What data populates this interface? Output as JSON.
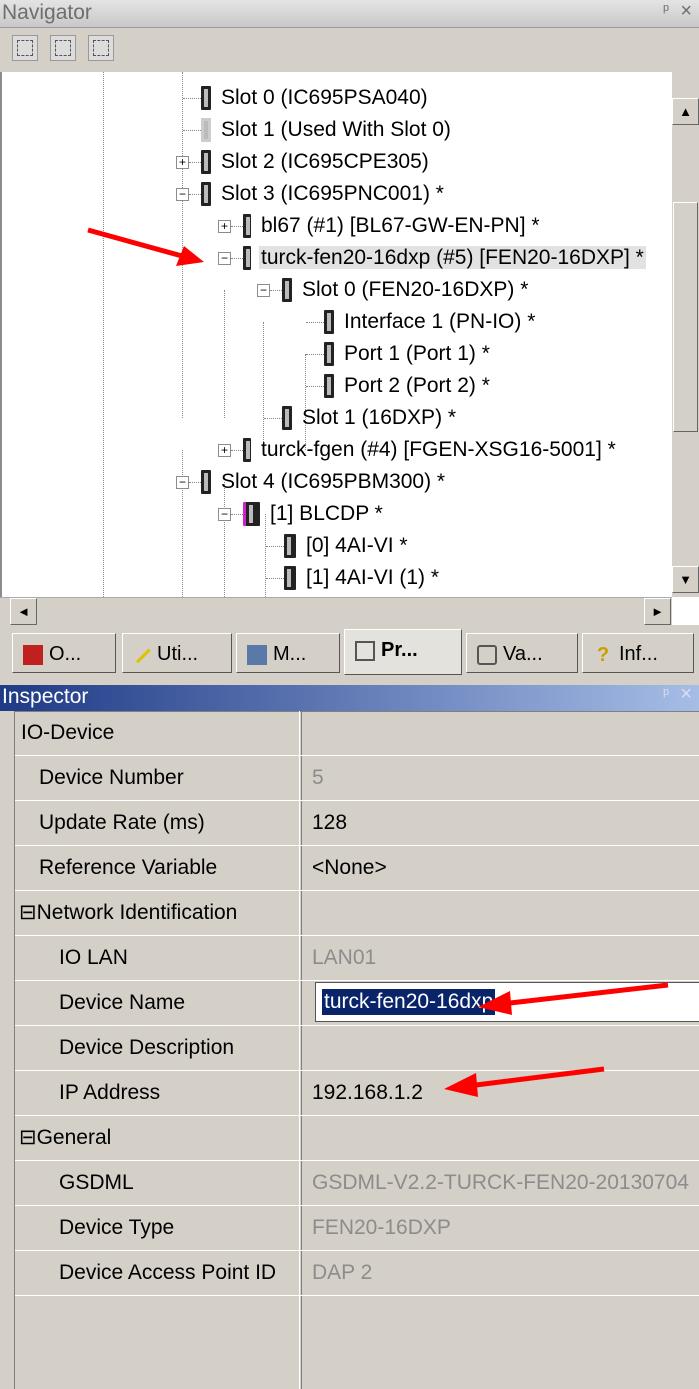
{
  "navigator": {
    "title": "Navigator",
    "pin_glyph": "ᵖ",
    "close_glyph": "×",
    "toolbar_icons": [
      "grid-view-icon",
      "split-view-icon",
      "tree-view-icon"
    ],
    "tree": [
      {
        "label": "Slot 0 (IC695PSA040)",
        "icon": "power-module-icon",
        "expander": ""
      },
      {
        "label": "Slot 1 (Used With Slot 0)",
        "icon": "empty-slot-icon",
        "expander": ""
      },
      {
        "label": "Slot 2 (IC695CPE305)",
        "icon": "module-icon",
        "expander": "+"
      },
      {
        "label": "Slot 3 (IC695PNC001) *",
        "icon": "module-icon",
        "expander": "−"
      },
      {
        "label": "bl67 (#1) [BL67-GW-EN-PN] *",
        "icon": "device-icon",
        "expander": "+"
      },
      {
        "label": "turck-fen20-16dxp (#5) [FEN20-16DXP] *",
        "icon": "device-icon",
        "expander": "−",
        "selected": true
      },
      {
        "label": "Slot  0 (FEN20-16DXP) *",
        "icon": "module-icon",
        "expander": "−"
      },
      {
        "label": "Interface  1 (PN-IO) *",
        "icon": "module-icon",
        "expander": ""
      },
      {
        "label": "Port  1 (Port 1) *",
        "icon": "module-icon",
        "expander": ""
      },
      {
        "label": "Port  2 (Port 2) *",
        "icon": "module-icon",
        "expander": ""
      },
      {
        "label": "Slot  1 (16DXP) *",
        "icon": "module-icon",
        "expander": ""
      },
      {
        "label": "turck-fgen (#4) [FGEN-XSG16-5001] *",
        "icon": "device-icon",
        "expander": "+"
      },
      {
        "label": "Slot 4 (IC695PBM300) *",
        "icon": "module-icon",
        "expander": "−"
      },
      {
        "label": "[1] BLCDP *",
        "icon": "profibus-device-icon",
        "expander": "−"
      },
      {
        "label": "[0] 4AI-VI *",
        "icon": "io-module-icon",
        "expander": ""
      },
      {
        "label": "[1] 4AI-VI (1) *",
        "icon": "io-module-icon",
        "expander": ""
      }
    ],
    "scroll_up": "▲",
    "scroll_down": "▼",
    "scroll_left": "◄",
    "scroll_right": "►"
  },
  "tabs": [
    {
      "label": "O...",
      "icon": "options-icon"
    },
    {
      "label": "Uti...",
      "icon": "utilities-icon"
    },
    {
      "label": "M...",
      "icon": "manager-icon"
    },
    {
      "label": "Pr...",
      "icon": "project-icon",
      "active": true
    },
    {
      "label": "Va...",
      "icon": "variables-icon"
    },
    {
      "label": "Inf...",
      "icon": "info-icon"
    }
  ],
  "inspector": {
    "title": "Inspector",
    "pin_glyph": "ᵖ",
    "close_glyph": "×",
    "rows": [
      {
        "key": "IO-Device",
        "value": "",
        "readonly": false
      },
      {
        "key": "Device Number",
        "value": "5",
        "readonly": true
      },
      {
        "key": "Update Rate (ms)",
        "value": "128",
        "readonly": false
      },
      {
        "key": "Reference Variable",
        "value": "<None>",
        "readonly": false
      },
      {
        "key": "⊟Network Identification",
        "value": "",
        "readonly": false
      },
      {
        "key": "IO LAN",
        "value": "LAN01",
        "readonly": true
      },
      {
        "key": "Device Name",
        "value": "turck-fen20-16dxp",
        "readonly": false,
        "editing": true
      },
      {
        "key": "Device Description",
        "value": "",
        "readonly": false
      },
      {
        "key": "IP Address",
        "value": "192.168.1.2",
        "readonly": false
      },
      {
        "key": "⊟General",
        "value": "",
        "readonly": false
      },
      {
        "key": "GSDML",
        "value": "GSDML-V2.2-TURCK-FEN20-20130704",
        "readonly": true
      },
      {
        "key": "Device Type",
        "value": "FEN20-16DXP",
        "readonly": true
      },
      {
        "key": "Device Access Point ID",
        "value": "DAP 2",
        "readonly": true
      }
    ]
  },
  "colors": {
    "annotation_arrow": "#ff0000",
    "inspector_title_start": "#1f3a86",
    "inspector_title_end": "#a6bde6",
    "selection": "#0a246a"
  }
}
